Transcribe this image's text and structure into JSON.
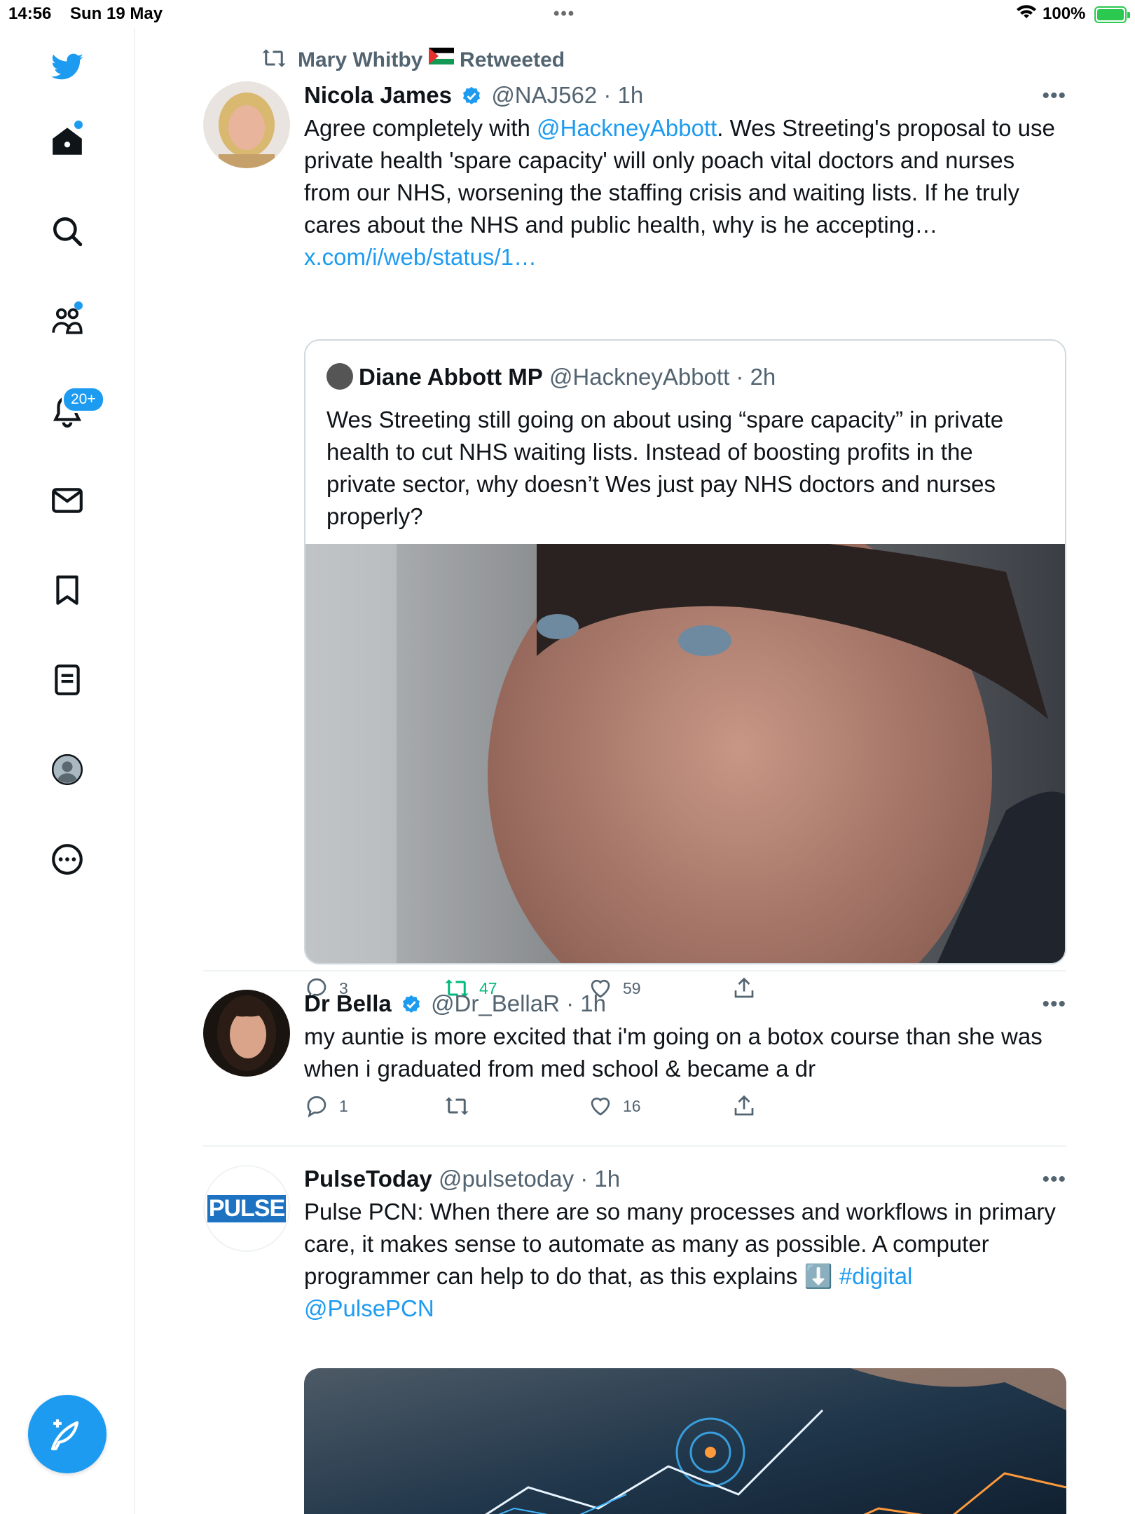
{
  "status_bar": {
    "time": "14:56",
    "date": "Sun 19 May",
    "battery": "100%"
  },
  "nav": {
    "items": [
      "home-icon",
      "search-icon",
      "communities-icon",
      "notifications-icon",
      "messages-icon",
      "bookmarks-icon",
      "lists-icon",
      "profile-icon",
      "more-icon"
    ],
    "notifications_badge": "20+",
    "compose": "compose-icon"
  },
  "tweets": [
    {
      "retweeted_by": "Mary Whitby",
      "retweeted_label": "Retweeted",
      "name": "Nicola James",
      "handle": "@NAJ562",
      "time": "· 1h",
      "text_before": "Agree completely with ",
      "mention": "@HackneyAbbott",
      "text_after": ". Wes Streeting's proposal to use private health 'spare capacity' will only poach vital doctors and nurses from our NHS, worsening the staffing crisis and waiting lists. If he truly cares about the NHS and public health, why is he accepting…",
      "link": "x.com/i/web/status/1…",
      "quote": {
        "name": "Diane Abbott MP",
        "handle": "@HackneyAbbott",
        "time": "· 2h",
        "text": "Wes Streeting still going on about using “spare capacity” in private health to cut NHS waiting lists. Instead of boosting profits in the private sector, why doesn’t Wes just pay NHS doctors and nurses properly?"
      },
      "replies": "3",
      "retweets": "47",
      "likes": "59"
    },
    {
      "name": "Dr Bella",
      "handle": "@Dr_BellaR",
      "time": "· 1h",
      "text": "my auntie is more excited that i'm going on a botox course than she was when i graduated from med school & became a dr",
      "replies": "1",
      "retweets": "",
      "likes": "16"
    },
    {
      "name": "PulseToday",
      "handle": "@pulsetoday",
      "time": "· 1h",
      "avatar_text": "PULSE",
      "text": "Pulse PCN: When there are so many processes and workflows in primary care, it makes sense to automate as many as possible. A computer programmer can help to do that, as this explains ⬇️ ",
      "hashtag": "#digital",
      "mention": "@PulsePCN"
    }
  ],
  "colors": {
    "accent": "#1d9bf0",
    "retweet": "#00ba7c",
    "muted": "#536471"
  }
}
